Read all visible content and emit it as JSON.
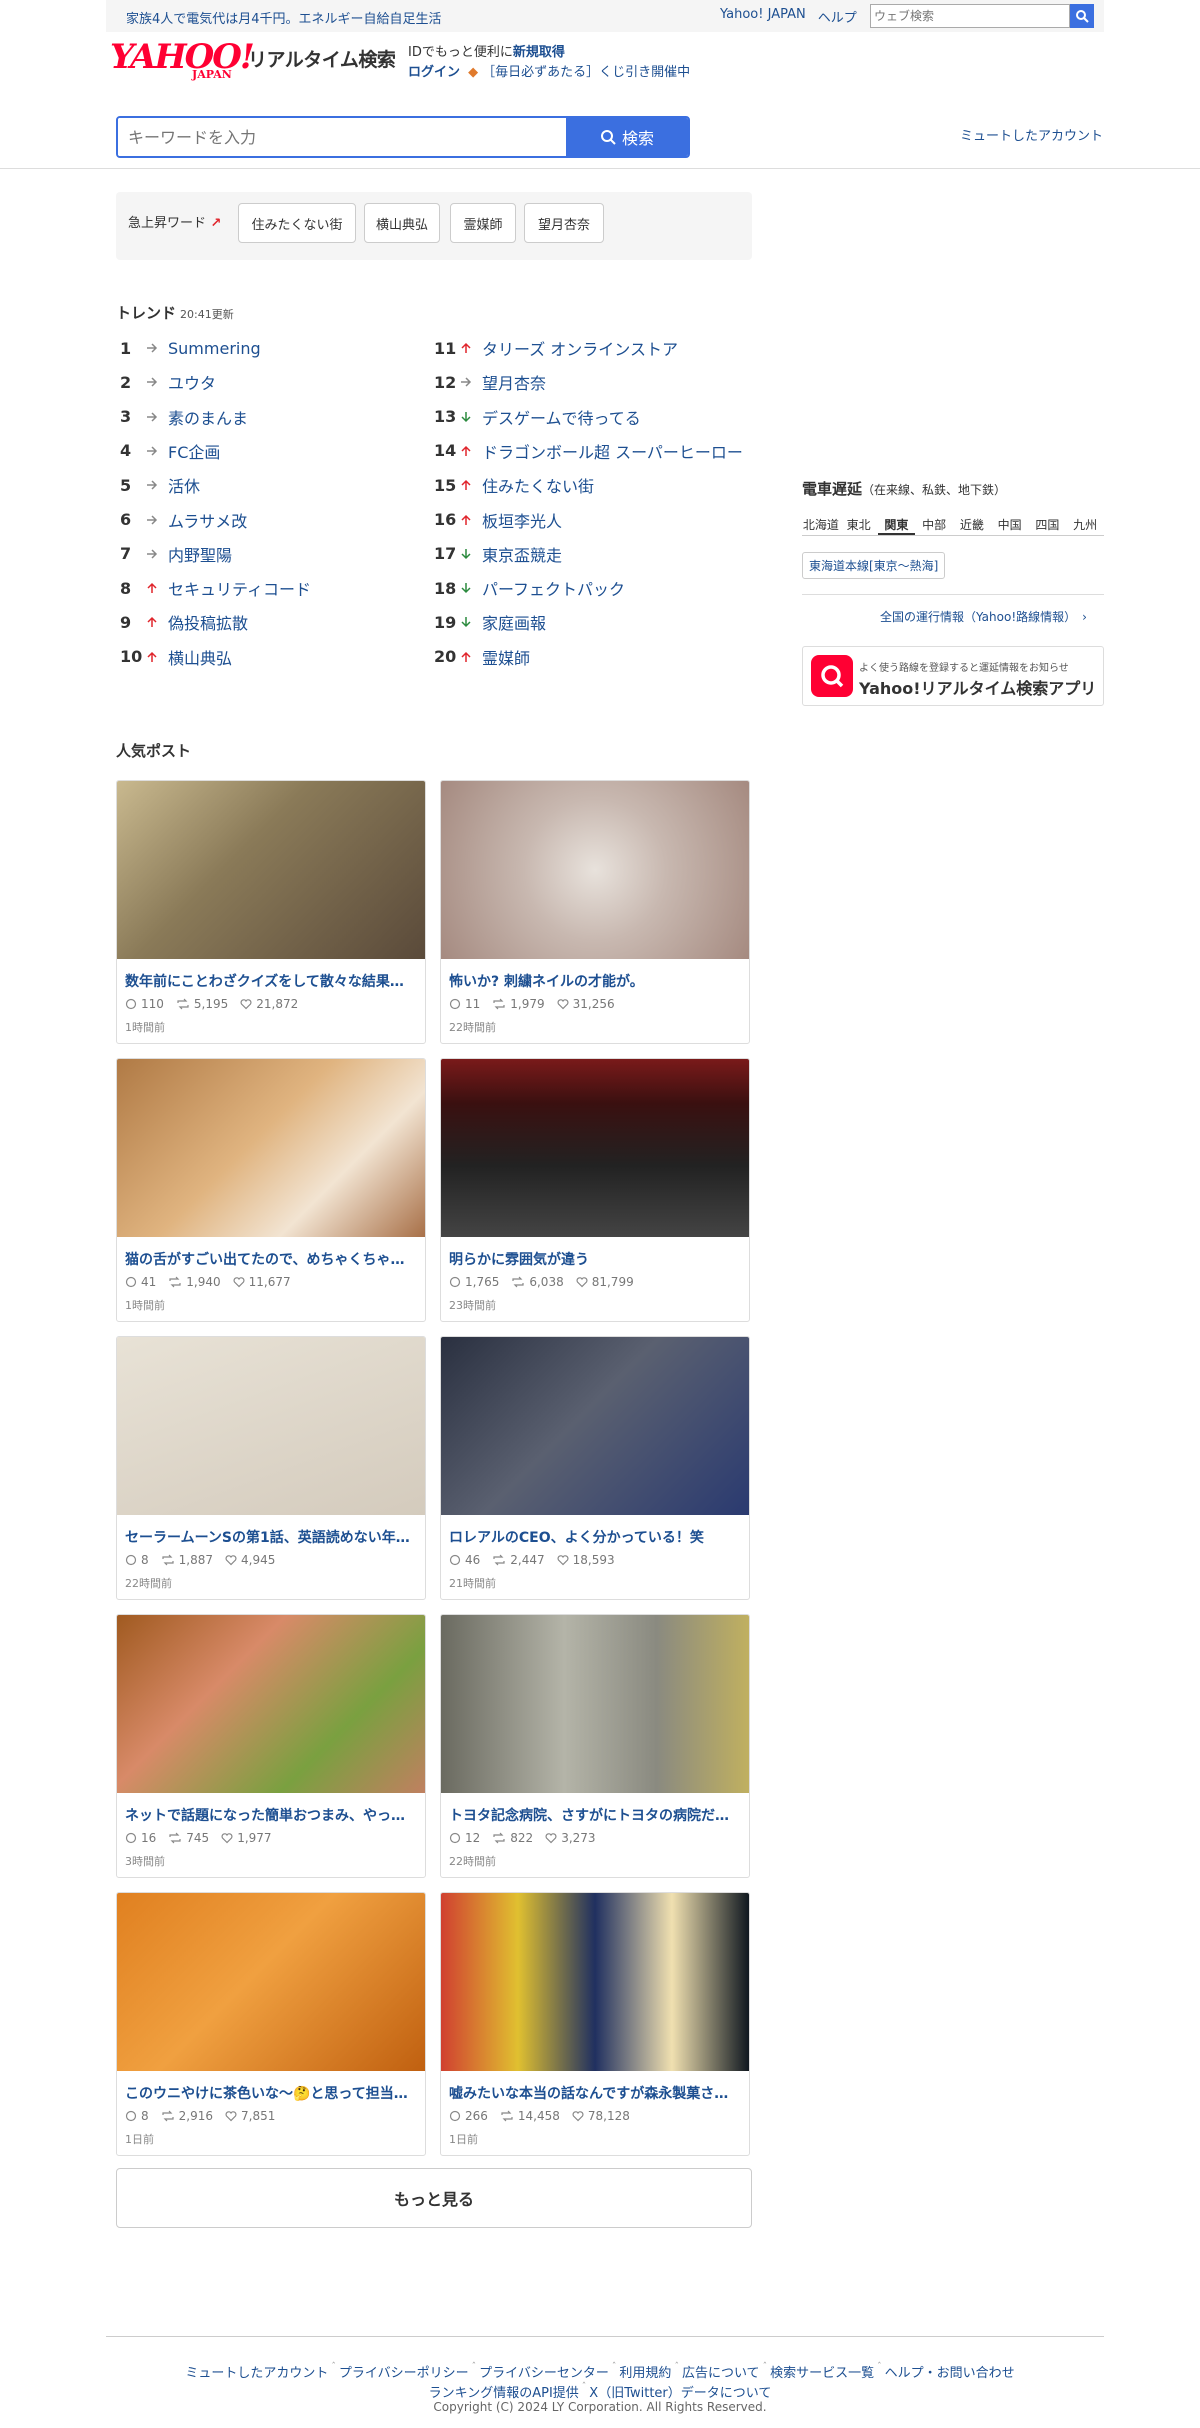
{
  "topbar": {
    "promo": "家族4人で電気代は月4千円。エネルギー自給自足生活",
    "links": [
      "Yahoo! JAPAN",
      "ヘルプ"
    ],
    "web_search_placeholder": "ウェブ検索"
  },
  "header": {
    "logo_main": "YAHOO!",
    "logo_sub": "JAPAN",
    "service_name": "リアルタイム検索",
    "id_promo_prefix": "IDでもっと便利に",
    "id_promo_link": "新規取得",
    "login": "ログイン",
    "lottery": "［毎日必ずあたる］くじ引き開催中"
  },
  "search": {
    "placeholder": "キーワードを入力",
    "button": "検索",
    "muted_accounts": "ミュートしたアカウント"
  },
  "rising": {
    "label": "急上昇ワード",
    "words": [
      "住みたくない街",
      "横山典弘",
      "霊媒師",
      "望月杏奈"
    ]
  },
  "trends": {
    "title": "トレンド",
    "updated": "20:41更新",
    "items": [
      {
        "rank": "1",
        "name": "Summering",
        "dir": "flat"
      },
      {
        "rank": "2",
        "name": "ユウタ",
        "dir": "flat"
      },
      {
        "rank": "3",
        "name": "素のまんま",
        "dir": "flat"
      },
      {
        "rank": "4",
        "name": "FC企画",
        "dir": "flat"
      },
      {
        "rank": "5",
        "name": "活休",
        "dir": "flat"
      },
      {
        "rank": "6",
        "name": "ムラサメ改",
        "dir": "flat"
      },
      {
        "rank": "7",
        "name": "内野聖陽",
        "dir": "flat"
      },
      {
        "rank": "8",
        "name": "セキュリティコード",
        "dir": "up"
      },
      {
        "rank": "9",
        "name": "偽投稿拡散",
        "dir": "up"
      },
      {
        "rank": "10",
        "name": "横山典弘",
        "dir": "up"
      },
      {
        "rank": "11",
        "name": "タリーズ オンラインストア",
        "dir": "up"
      },
      {
        "rank": "12",
        "name": "望月杏奈",
        "dir": "flat"
      },
      {
        "rank": "13",
        "name": "デスゲームで待ってる",
        "dir": "down"
      },
      {
        "rank": "14",
        "name": "ドラゴンボール超 スーパーヒーロー",
        "dir": "up"
      },
      {
        "rank": "15",
        "name": "住みたくない街",
        "dir": "up"
      },
      {
        "rank": "16",
        "name": "板垣李光人",
        "dir": "up"
      },
      {
        "rank": "17",
        "name": "東京盃競走",
        "dir": "down"
      },
      {
        "rank": "18",
        "name": "パーフェクトパック",
        "dir": "down"
      },
      {
        "rank": "19",
        "name": "家庭画報",
        "dir": "down"
      },
      {
        "rank": "20",
        "name": "霊媒師",
        "dir": "up"
      }
    ]
  },
  "popular": {
    "title": "人気ポスト",
    "posts": [
      {
        "title": "数年前にことわざクイズをして散々な結果…",
        "replies": "110",
        "reposts": "5,195",
        "likes": "21,872",
        "ago": "1時間前"
      },
      {
        "title": "怖いか? 刺繍ネイルの才能が。",
        "replies": "11",
        "reposts": "1,979",
        "likes": "31,256",
        "ago": "22時間前"
      },
      {
        "title": "猫の舌がすごい出てたので、めちゃくちゃ…",
        "replies": "41",
        "reposts": "1,940",
        "likes": "11,677",
        "ago": "1時間前"
      },
      {
        "title": "明らかに雰囲気が違う",
        "replies": "1,765",
        "reposts": "6,038",
        "likes": "81,799",
        "ago": "23時間前"
      },
      {
        "title": "セーラームーンSの第1話、英語読めない年…",
        "replies": "8",
        "reposts": "1,887",
        "likes": "4,945",
        "ago": "22時間前"
      },
      {
        "title": "ロレアルのCEO、よく分かっている！笑",
        "replies": "46",
        "reposts": "2,447",
        "likes": "18,593",
        "ago": "21時間前"
      },
      {
        "title": "ネットで話題になった簡単おつまみ、やっ…",
        "replies": "16",
        "reposts": "745",
        "likes": "1,977",
        "ago": "3時間前"
      },
      {
        "title": "トヨタ記念病院、さすがにトヨタの病院だ…",
        "replies": "12",
        "reposts": "822",
        "likes": "3,273",
        "ago": "22時間前"
      },
      {
        "title": "このウニやけに茶色いな〜🤔と思って担当に…",
        "replies": "8",
        "reposts": "2,916",
        "likes": "7,851",
        "ago": "1日前"
      },
      {
        "title": "嘘みたいな本当の話なんですが森永製菓さ…",
        "replies": "266",
        "reposts": "14,458",
        "likes": "78,128",
        "ago": "1日前"
      }
    ],
    "more": "もっと見る"
  },
  "trains": {
    "title": "電車遅延",
    "subtitle": "（在来線、私鉄、地下鉄）",
    "regions": [
      "北海道",
      "東北",
      "関東",
      "中部",
      "近畿",
      "中国",
      "四国",
      "九州"
    ],
    "active_region": "関東",
    "line": "東海道本線[東京〜熱海]",
    "all_info": "全国の運行情報（Yahoo!路線情報）"
  },
  "app": {
    "sub": "よく使う路線を登録すると運延情報をお知らせ",
    "name": "Yahoo!リアルタイム検索アプリ"
  },
  "footer": {
    "links1": [
      "ミュートしたアカウント",
      "プライバシーポリシー",
      "プライバシーセンター",
      "利用規約",
      "広告について",
      "検索サービス一覧",
      "ヘルプ・お問い合わせ"
    ],
    "links2": [
      "ランキング情報のAPI提供",
      "X（旧Twitter）データについて"
    ],
    "copyright": "Copyright (C) 2024 LY Corporation. All Rights Reserved."
  },
  "colors": {
    "accent": "#3b6fe0",
    "link": "#1d4f91",
    "up": "#e0252c",
    "down": "#2b8a3e",
    "brand": "#ff0033"
  }
}
